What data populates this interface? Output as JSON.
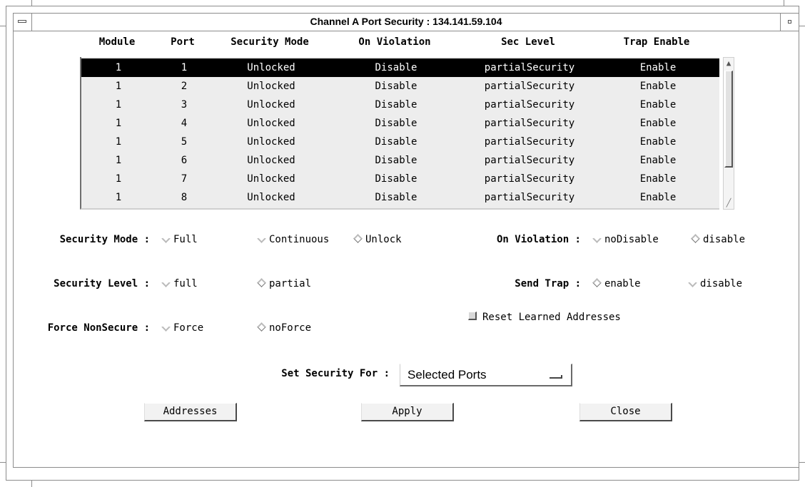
{
  "window": {
    "title": "Channel A Port Security : 134.141.59.104"
  },
  "table": {
    "columns": [
      "Module",
      "Port",
      "Security Mode",
      "On Violation",
      "Sec Level",
      "Trap Enable"
    ],
    "rows": [
      {
        "module": "1",
        "port": "1",
        "security_mode": "Unlocked",
        "on_violation": "Disable",
        "sec_level": "partialSecurity",
        "trap_enable": "Enable",
        "selected": true
      },
      {
        "module": "1",
        "port": "2",
        "security_mode": "Unlocked",
        "on_violation": "Disable",
        "sec_level": "partialSecurity",
        "trap_enable": "Enable"
      },
      {
        "module": "1",
        "port": "3",
        "security_mode": "Unlocked",
        "on_violation": "Disable",
        "sec_level": "partialSecurity",
        "trap_enable": "Enable"
      },
      {
        "module": "1",
        "port": "4",
        "security_mode": "Unlocked",
        "on_violation": "Disable",
        "sec_level": "partialSecurity",
        "trap_enable": "Enable"
      },
      {
        "module": "1",
        "port": "5",
        "security_mode": "Unlocked",
        "on_violation": "Disable",
        "sec_level": "partialSecurity",
        "trap_enable": "Enable"
      },
      {
        "module": "1",
        "port": "6",
        "security_mode": "Unlocked",
        "on_violation": "Disable",
        "sec_level": "partialSecurity",
        "trap_enable": "Enable"
      },
      {
        "module": "1",
        "port": "7",
        "security_mode": "Unlocked",
        "on_violation": "Disable",
        "sec_level": "partialSecurity",
        "trap_enable": "Enable"
      },
      {
        "module": "1",
        "port": "8",
        "security_mode": "Unlocked",
        "on_violation": "Disable",
        "sec_level": "partialSecurity",
        "trap_enable": "Enable"
      }
    ]
  },
  "form": {
    "security_mode": {
      "label": "Security Mode :",
      "options": [
        "Full",
        "Continuous",
        "Unlock"
      ],
      "selected": "Unlock"
    },
    "on_violation": {
      "label": "On Violation :",
      "options": [
        "noDisable",
        "disable"
      ],
      "selected": "disable"
    },
    "security_level": {
      "label": "Security Level :",
      "options": [
        "full",
        "partial"
      ],
      "selected": "partial"
    },
    "send_trap": {
      "label": "Send Trap :",
      "options": [
        "enable",
        "disable"
      ],
      "selected": "enable"
    },
    "force_nonsecure": {
      "label": "Force NonSecure :",
      "options": [
        "Force",
        "noForce"
      ],
      "selected": "noForce"
    },
    "reset_learned": {
      "label": "Reset Learned Addresses",
      "checked": false
    },
    "set_security_for": {
      "label": "Set Security For :",
      "value": "Selected Ports"
    }
  },
  "buttons": {
    "addresses": "Addresses",
    "apply": "Apply",
    "close": "Close"
  },
  "colors": {
    "selected_row_bg": "#000000",
    "list_bg": "#ededed",
    "frame": "#8c8c8c"
  }
}
